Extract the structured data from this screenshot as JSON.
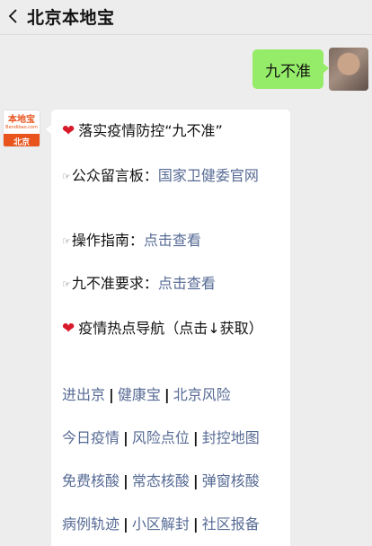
{
  "header": {
    "title": "北京本地宝"
  },
  "outgoing": {
    "text": "九不准"
  },
  "bot": {
    "logo_text": "本地宝",
    "logo_sub": "Bendibao.com",
    "logo_city": "北京"
  },
  "message": {
    "heading1": "落实疫情防控“九不准”",
    "comment_label": "公众留言板：",
    "comment_link": "国家卫健委官网",
    "guide_label": "操作指南：",
    "guide_link": "点击查看",
    "rules_label": "九不准要求：",
    "rules_link": "点击查看",
    "heading2": "疫情热点导航（点击↓获取）",
    "nav_rows": [
      [
        "进出京",
        "健康宝",
        "北京风险"
      ],
      [
        "今日疫情",
        "风险点位",
        "封控地图"
      ],
      [
        "免费核酸",
        "常态核酸",
        "弹窗核酸"
      ],
      [
        "病例轨迹",
        "小区解封",
        "社区报备"
      ]
    ],
    "separator": "|"
  }
}
